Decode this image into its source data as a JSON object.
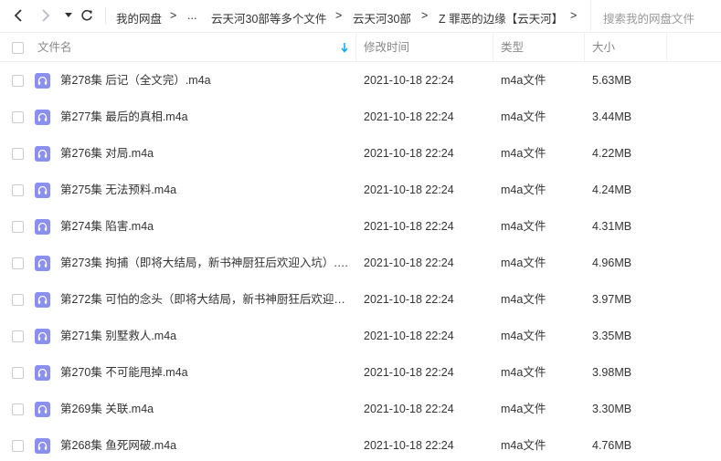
{
  "toolbar": {
    "back_icon": "chevron-left-icon",
    "forward_icon": "chevron-right-icon",
    "history_dropdown_icon": "caret-down-icon",
    "refresh_icon": "refresh-icon"
  },
  "breadcrumb": {
    "items": [
      "我的网盘",
      "...",
      "云天河30部等多个文件",
      "云天河30部",
      "Z 罪恶的边缘【云天河】"
    ],
    "separator": ">"
  },
  "search": {
    "placeholder": "搜索我的网盘文件"
  },
  "columns": {
    "name": "文件名",
    "modified": "修改时间",
    "type": "类型",
    "size": "大小",
    "sort_icon": "sort-down-arrow-icon"
  },
  "colors": {
    "accent": "#06a7ff",
    "audio_icon": "#8a8ff0"
  },
  "files": [
    {
      "name": "第278集 后记（全文完）.m4a",
      "modified": "2021-10-18 22:24",
      "type": "m4a文件",
      "size": "5.63MB"
    },
    {
      "name": "第277集 最后的真相.m4a",
      "modified": "2021-10-18 22:24",
      "type": "m4a文件",
      "size": "3.44MB"
    },
    {
      "name": "第276集 对局.m4a",
      "modified": "2021-10-18 22:24",
      "type": "m4a文件",
      "size": "4.22MB"
    },
    {
      "name": "第275集 无法预料.m4a",
      "modified": "2021-10-18 22:24",
      "type": "m4a文件",
      "size": "4.24MB"
    },
    {
      "name": "第274集 陷害.m4a",
      "modified": "2021-10-18 22:24",
      "type": "m4a文件",
      "size": "4.31MB"
    },
    {
      "name": "第273集 拘捕（即将大结局，新书神厨狂后欢迎入坑）.m...",
      "modified": "2021-10-18 22:24",
      "type": "m4a文件",
      "size": "4.96MB"
    },
    {
      "name": "第272集 可怕的念头（即将大结局，新书神厨狂后欢迎入...",
      "modified": "2021-10-18 22:24",
      "type": "m4a文件",
      "size": "3.97MB"
    },
    {
      "name": "第271集 别墅救人.m4a",
      "modified": "2021-10-18 22:24",
      "type": "m4a文件",
      "size": "3.35MB"
    },
    {
      "name": "第270集 不可能甩掉.m4a",
      "modified": "2021-10-18 22:24",
      "type": "m4a文件",
      "size": "3.98MB"
    },
    {
      "name": "第269集 关联.m4a",
      "modified": "2021-10-18 22:24",
      "type": "m4a文件",
      "size": "3.30MB"
    },
    {
      "name": "第268集 鱼死网破.m4a",
      "modified": "2021-10-18 22:24",
      "type": "m4a文件",
      "size": "4.76MB"
    }
  ]
}
